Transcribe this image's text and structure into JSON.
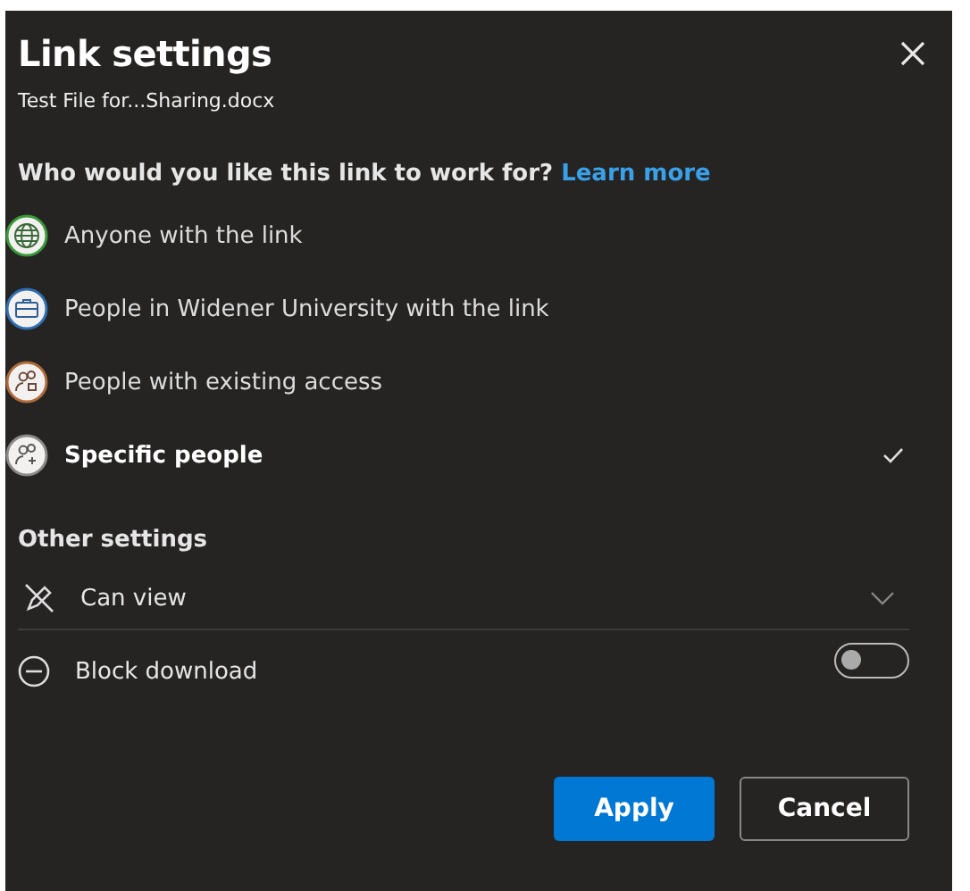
{
  "dialog": {
    "title": "Link settings",
    "file_name": "Test File for...Sharing.docx"
  },
  "question": {
    "text": "Who would you like this link to work for?",
    "link": "Learn more"
  },
  "options": [
    {
      "label": "Anyone with the link",
      "kind": "globe",
      "selected": false
    },
    {
      "label": "People in Widener University with the link",
      "kind": "briefcase",
      "selected": false
    },
    {
      "label": "People with existing access",
      "kind": "lock-people",
      "selected": false
    },
    {
      "label": "Specific people",
      "kind": "add-people",
      "selected": true
    }
  ],
  "other_settings": {
    "heading": "Other settings",
    "permission": "Can view",
    "block_download": {
      "label": "Block download",
      "on": false
    }
  },
  "buttons": {
    "apply": "Apply",
    "cancel": "Cancel"
  }
}
